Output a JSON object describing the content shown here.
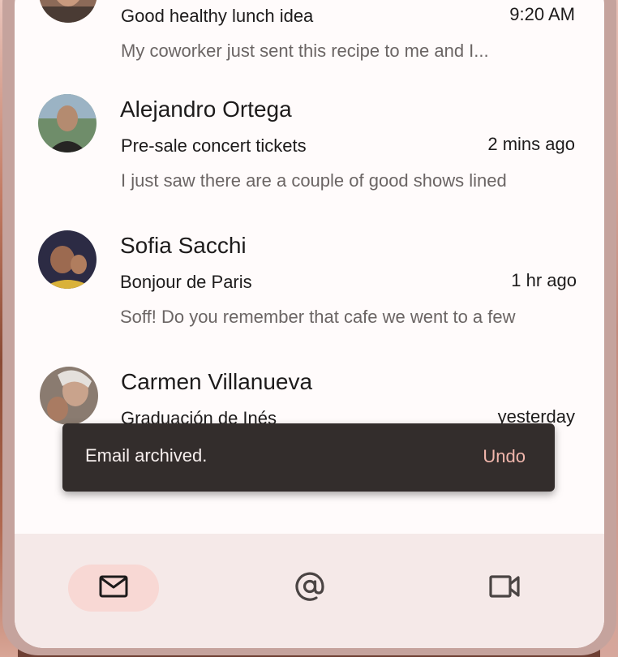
{
  "emails": [
    {
      "sender": "",
      "subject": "Good healthy lunch idea",
      "time": "9:20 AM",
      "preview": "My coworker just sent this recipe to me and I..."
    },
    {
      "sender": "Alejandro Ortega",
      "subject": "Pre-sale concert tickets",
      "time": "2 mins ago",
      "preview": "I just saw there are a couple of good shows lined"
    },
    {
      "sender": "Sofia Sacchi",
      "subject": "Bonjour de Paris",
      "time": "1 hr ago",
      "preview": "Soff! Do you remember that cafe we went to a few"
    },
    {
      "sender": "Carmen Villanueva",
      "subject": "Graduación de Inés",
      "time": "yesterday",
      "preview": ""
    }
  ],
  "snackbar": {
    "message": "Email archived.",
    "action": "Undo"
  },
  "nav": {
    "items": [
      {
        "icon": "mail-icon",
        "active": true
      },
      {
        "icon": "at-sign-icon",
        "active": false
      },
      {
        "icon": "video-camera-icon",
        "active": false
      }
    ]
  },
  "colors": {
    "surface": "#fffbfb",
    "snackbar_bg": "#332d2c",
    "snackbar_action": "#f2b7ad",
    "nav_bg": "#f5e9e8",
    "nav_active_pill": "#f8d8d4",
    "text_primary": "#1d1b1b",
    "text_secondary": "#6b6564"
  }
}
